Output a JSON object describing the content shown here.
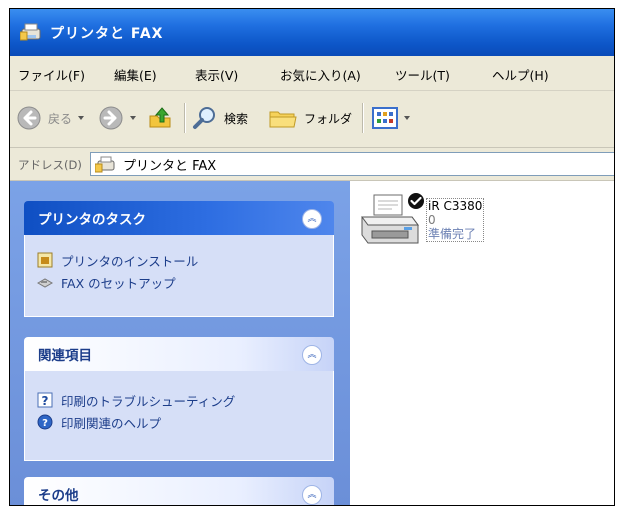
{
  "window": {
    "title": "プリンタと FAX"
  },
  "menu": {
    "items": [
      "ファイル(F)",
      "編集(E)",
      "表示(V)",
      "お気に入り(A)",
      "ツール(T)",
      "ヘルプ(H)"
    ]
  },
  "toolbar": {
    "back_label": "戻る",
    "search_label": "検索",
    "folders_label": "フォルダ"
  },
  "address": {
    "label": "アドレス(D)",
    "value": "プリンタと FAX"
  },
  "task_pane": {
    "printer_tasks": {
      "title": "プリンタのタスク",
      "items": [
        "プリンタのインストール",
        "FAX のセットアップ"
      ]
    },
    "related": {
      "title": "関連項目",
      "items": [
        "印刷のトラブルシューティング",
        "印刷関連のヘルプ"
      ]
    },
    "other": {
      "title": "その他"
    }
  },
  "printer": {
    "name": "iR C3380",
    "documents": "0",
    "status": "準備完了"
  },
  "icons": {
    "title": "printers-folder-icon",
    "back": "back-arrow-icon",
    "forward": "forward-arrow-icon",
    "up": "up-folder-icon",
    "search": "magnifier-icon",
    "folders": "folder-icon",
    "views": "views-grid-icon",
    "default_printer": "default-check-icon"
  },
  "colors": {
    "titlebar": "#0d56c8",
    "taskpane": "#6b8fd8",
    "panel_header_blue": "#0f4fc3",
    "panel_body": "#d6dff7",
    "link_text": "#1c3d8a"
  }
}
